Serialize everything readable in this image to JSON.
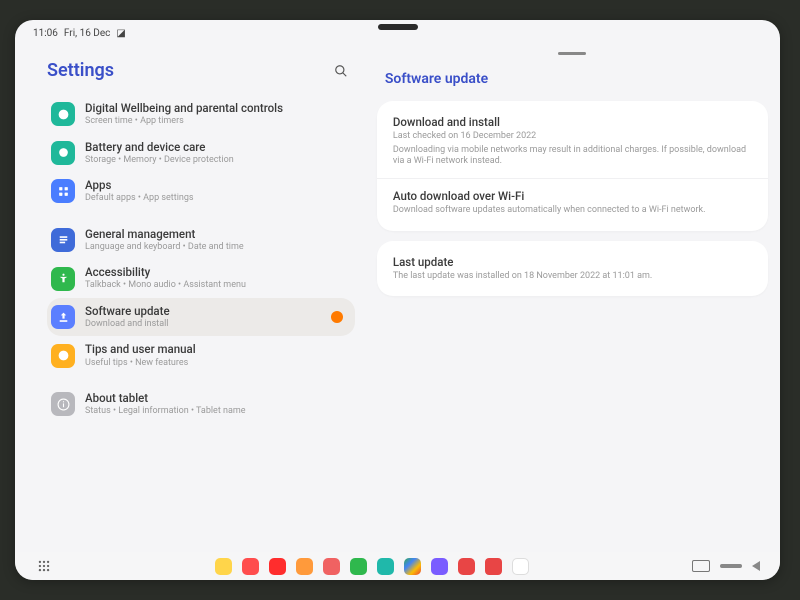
{
  "status": {
    "time": "11:06",
    "date": "Fri, 16 Dec"
  },
  "sidebar": {
    "title": "Settings",
    "items": [
      {
        "label": "Digital Wellbeing and parental controls",
        "sub": "Screen time • App timers"
      },
      {
        "label": "Battery and device care",
        "sub": "Storage • Memory • Device protection"
      },
      {
        "label": "Apps",
        "sub": "Default apps • App settings"
      },
      {
        "label": "General management",
        "sub": "Language and keyboard • Date and time"
      },
      {
        "label": "Accessibility",
        "sub": "Talkback • Mono audio • Assistant menu"
      },
      {
        "label": "Software update",
        "sub": "Download and install"
      },
      {
        "label": "Tips and user manual",
        "sub": "Useful tips • New features"
      },
      {
        "label": "About tablet",
        "sub": "Status • Legal information • Tablet name"
      }
    ]
  },
  "page": {
    "title": "Software update",
    "download": {
      "title": "Download and install",
      "line1": "Last checked on 16 December 2022",
      "line2": "Downloading via mobile networks may result in additional charges. If possible, download via a Wi-Fi network instead."
    },
    "auto": {
      "title": "Auto download over Wi-Fi",
      "sub": "Download software updates automatically when connected to a Wi-Fi network."
    },
    "last": {
      "title": "Last update",
      "sub": "The last update was installed on 18 November 2022 at 11:01 am."
    }
  }
}
